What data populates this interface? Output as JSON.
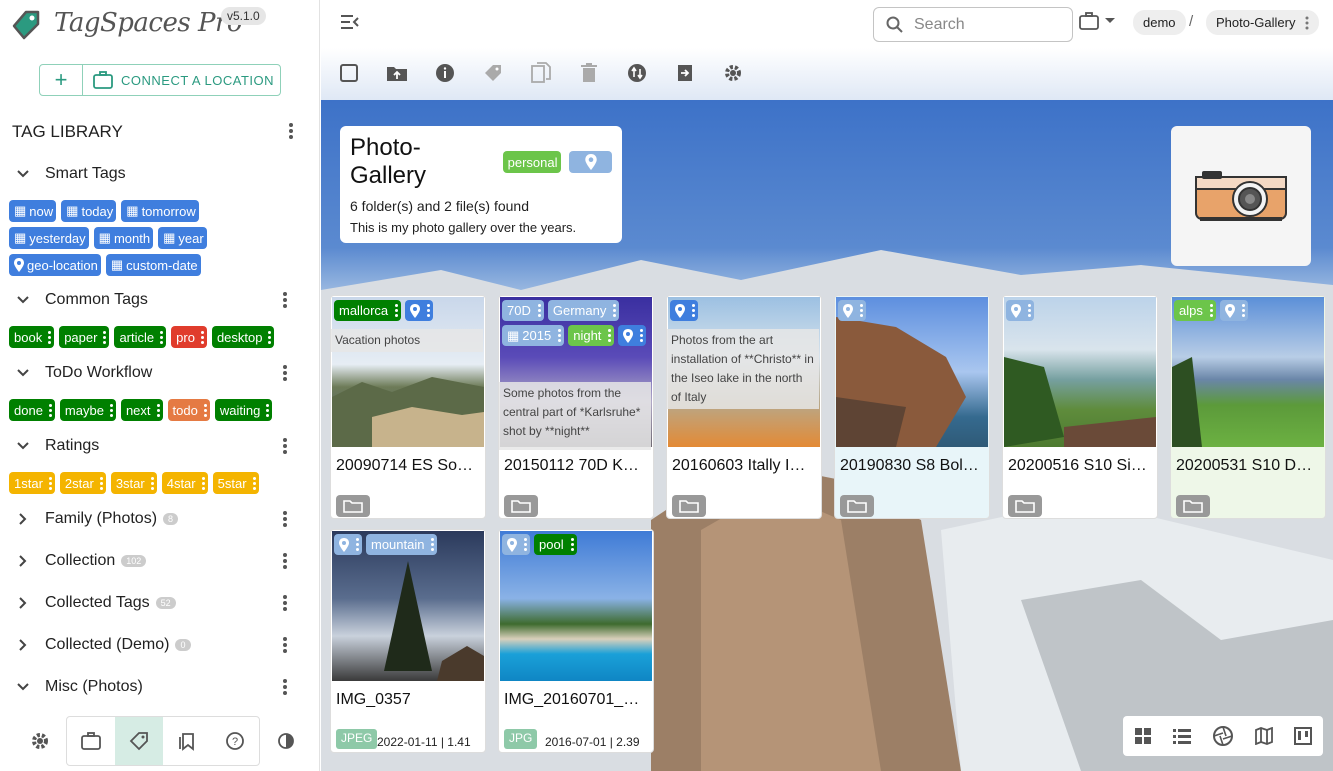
{
  "app": {
    "name": "TagSpaces Pro",
    "version": "v5.1.0",
    "connect_label": "CONNECT A LOCATION"
  },
  "sidebar": {
    "title": "TAG LIBRARY",
    "groups": [
      {
        "name": "Smart Tags",
        "expanded": true
      },
      {
        "name": "Common Tags",
        "expanded": true
      },
      {
        "name": "ToDo Workflow",
        "expanded": true
      },
      {
        "name": "Ratings",
        "expanded": true
      },
      {
        "name": "Family (Photos)",
        "count": "8",
        "expanded": false
      },
      {
        "name": "Collection",
        "count": "102",
        "expanded": false
      },
      {
        "name": "Collected Tags",
        "count": "52",
        "expanded": false
      },
      {
        "name": "Collected (Demo)",
        "count": "0",
        "expanded": false
      },
      {
        "name": "Misc (Photos)",
        "expanded": true
      }
    ],
    "smart_tags": [
      "now",
      "today",
      "tomorrow",
      "yesterday",
      "month",
      "year",
      "geo-location",
      "custom-date"
    ],
    "common_tags": [
      "book",
      "paper",
      "article",
      "pro",
      "desktop"
    ],
    "todo_tags": [
      "done",
      "maybe",
      "next",
      "todo",
      "waiting"
    ],
    "rating_tags": [
      "1star",
      "2star",
      "3star",
      "4star",
      "5star"
    ]
  },
  "header": {
    "search_placeholder": "Search",
    "breadcrumb": [
      "demo",
      "Photo-Gallery"
    ],
    "separator": "/"
  },
  "folder": {
    "title": "Photo-Gallery",
    "tag": "personal",
    "found": "6 folder(s) and 2 file(s) found",
    "description": "This is my photo gallery over the years."
  },
  "entries": [
    {
      "name": "20090714 ES So…",
      "tags": [
        "mallorca"
      ],
      "description": "Vacation photos"
    },
    {
      "name": "20150112 70D K…",
      "tags": [
        "70D",
        "Germany",
        "2015",
        "night"
      ],
      "description": "Some photos from the central part of *Karlsruhe* shot by **night**"
    },
    {
      "name": "20160603 Itally I…",
      "tags": [],
      "description": "Photos from the art installation of **Christo** in the Iseo lake in the north of Italy"
    },
    {
      "name": "20190830 S8 Bol…",
      "tags": []
    },
    {
      "name": "20200516 S10 Si…",
      "tags": []
    },
    {
      "name": "20200531 S10 D…",
      "tags": [
        "alps"
      ]
    },
    {
      "name": "IMG_0357",
      "tags": [
        "mountain"
      ],
      "ext": "JPEG",
      "meta": "2022-01-11 | 1.41"
    },
    {
      "name": "IMG_20160701_…",
      "tags": [
        "pool"
      ],
      "ext": "JPG",
      "meta": "2016-07-01 | 2.39"
    }
  ],
  "colors": {
    "accent": "#2b9a80",
    "tag_blue": "#3f7ede",
    "tag_green": "#008000",
    "tag_red": "#e03c2c",
    "tag_orange": "#e57a43",
    "tag_yellow": "#f4b400",
    "tag_lightgreen": "#6cc54a",
    "tag_lightblue": "#8fb4e0"
  }
}
